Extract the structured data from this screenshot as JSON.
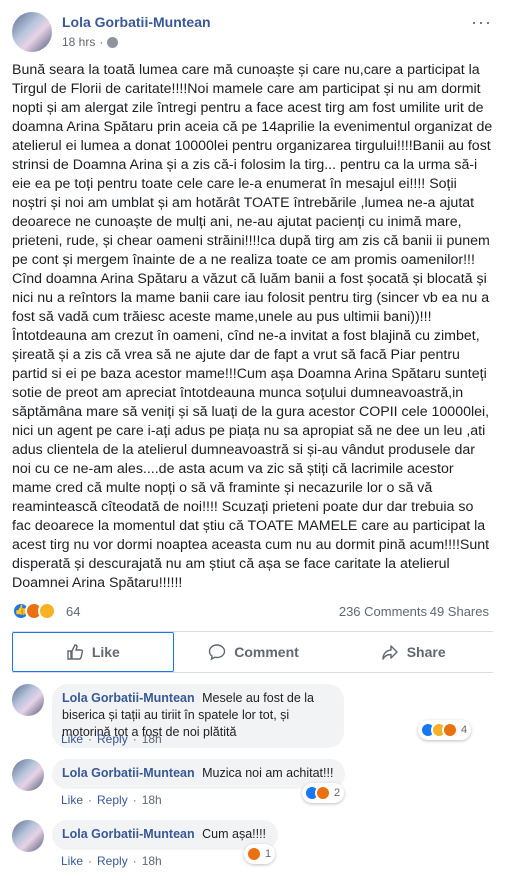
{
  "post": {
    "author": "Lola Gorbatii-Muntean",
    "time": "18 hrs",
    "separator": "·",
    "more": "···",
    "text": "Bună seara la toată lumea care mă cunoaște și care nu,care a participat la Tirgul de Florii de caritate!!!!Noi mamele care am participat și nu am dormit nopti și am alergat zile întregi pentru a face acest tirg am fost umilite urit de doamna Arina Spătaru prin aceia că pe 14aprilie la evenimentul organizat de atelierul ei lumea a donat 10000lei pentru organizarea tirgului!!!!Banii au fost strinsi de Doamna Arina și a zis că-i folosim la tirg... pentru ca la urma să-i eie ea pe toți pentru toate cele care le-a enumerat în mesajul ei!!!! Soții noștri și noi am umblat și am hotărât TOATE întrebările ,lumea ne-a ajutat deoarece ne cunoaște de mulți ani, ne-au ajutat pacienți cu inimă mare, prieteni, rude, și chear oameni străini!!!!ca după tirg am zis că banii ii punem pe cont și mergem înainte de a ne realiza toate ce am promis oamenilor!!! Cînd doamna Arina Spătaru a văzut că luăm banii a fost șocată și blocată și nici nu a reîntors la mame banii care iau folosit pentru tirg (sincer vb ea nu a fost să vadă cum trăiesc aceste mame,unele au pus ultimii bani))!!!\nÎntotdeauna am crezut în oameni, cînd ne-a invitat a fost blajină cu zimbet, șireată și a zis că vrea să ne ajute dar de fapt a vrut să facă Piar pentru partid si ei pe baza acestor mame!!!Cum așa Doamna Arina Spătaru sunteți sotie de preot am apreciat întotdeauna munca soțului dumneavoastră,in săptămâna mare să veniți și să luați de la gura acestor COPII cele 10000lei, nici un agent pe care i-ați adus pe piața nu sa apropiat să ne dee un leu ,ati adus clientela de la atelierul dumneavoastră si și-au vândut produsele dar noi cu ce ne-am ales....de asta acum va zic să știți că lacrimile acestor mame cred că multe nopți o să vă framinte și necazurile lor o să vă reamintească cîteodată de noi!!!! Scuzați prieteni poate dur dar trebuia so fac deoarece la momentul dat știu că TOATE MAMELE care au participat la acest tirg nu vor dormi noaptea aceasta cum nu au dormit pină acum!!!!Sunt disperată și descurajată nu am știut că așa se face caritate la atelierul Doamnei Arina Spătaru!!!!!!"
  },
  "reactions": {
    "icons": [
      "like",
      "angry",
      "sad"
    ],
    "count": "64",
    "comments": "236 Comments",
    "shares": "49 Shares"
  },
  "actions": {
    "like": "Like",
    "comment": "Comment",
    "share": "Share"
  },
  "comments": [
    {
      "author": "Lola Gorbatii-Muntean",
      "text": "Mesele au fost de la biserica și tații au tiriit în spatele lor tot, și motorină tot a fost de noi plătită",
      "like": "Like",
      "reply": "Reply",
      "time": "18h",
      "reaction_icons": [
        "like",
        "wow",
        "angry"
      ],
      "reaction_count": "4"
    },
    {
      "author": "Lola Gorbatii-Muntean",
      "text": "Muzica noi am achitat!!!",
      "like": "Like",
      "reply": "Reply",
      "time": "18h",
      "reaction_icons": [
        "like",
        "angry"
      ],
      "reaction_count": "2"
    },
    {
      "author": "Lola Gorbatii-Muntean",
      "text": "Cum așa!!!!",
      "like": "Like",
      "reply": "Reply",
      "time": "18h",
      "reaction_icons": [
        "angry"
      ],
      "reaction_count": "1"
    }
  ],
  "colors": {
    "link": "#385898",
    "like_blue": "#1877f2",
    "angry": "#e9710f",
    "sad": "#f7b125",
    "muted": "#606770"
  }
}
